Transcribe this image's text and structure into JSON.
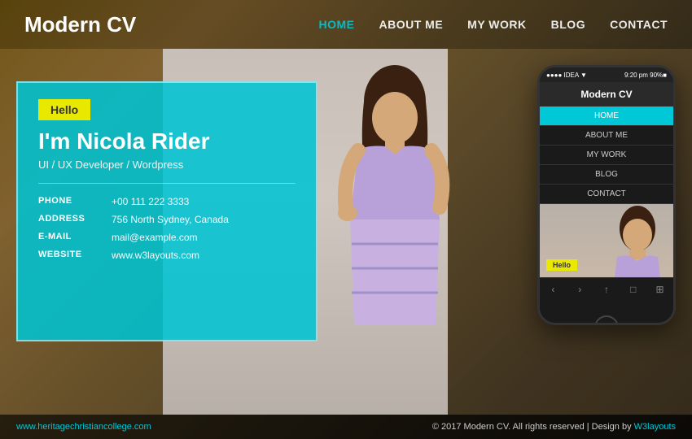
{
  "logo": "Modern CV",
  "nav": {
    "items": [
      {
        "label": "HOME",
        "active": true
      },
      {
        "label": "ABOUT ME",
        "active": false
      },
      {
        "label": "MY WORK",
        "active": false
      },
      {
        "label": "BLOG",
        "active": false
      },
      {
        "label": "CONTACT",
        "active": false
      }
    ]
  },
  "card": {
    "hello_badge": "Hello",
    "name": "I'm Nicola Rider",
    "role": "UI / UX Developer / Wordpress",
    "phone_label": "PHONE",
    "phone_value": "+00 111 222 3333",
    "address_label": "ADDRESS",
    "address_value": "756 North Sydney, Canada",
    "email_label": "E-MAIL",
    "email_value": "mail@example.com",
    "website_label": "WEBSITE",
    "website_value": "www.w3layouts.com"
  },
  "mobile": {
    "status_left": "●●●● IDEA ▼",
    "status_right": "9:20 pm   90%■",
    "logo": "Modern CV",
    "nav_items": [
      {
        "label": "HOME",
        "active": true
      },
      {
        "label": "ABOUT ME",
        "active": false
      },
      {
        "label": "MY WORK",
        "active": false
      },
      {
        "label": "BLOG",
        "active": false
      },
      {
        "label": "CONTACT",
        "active": false
      }
    ],
    "hello_badge": "Hello"
  },
  "footer": {
    "left_link": "www.heritagechristiancollege.com",
    "copyright": "© 2017 Modern CV. All rights reserved | Design by",
    "design_link": "W3layouts"
  }
}
